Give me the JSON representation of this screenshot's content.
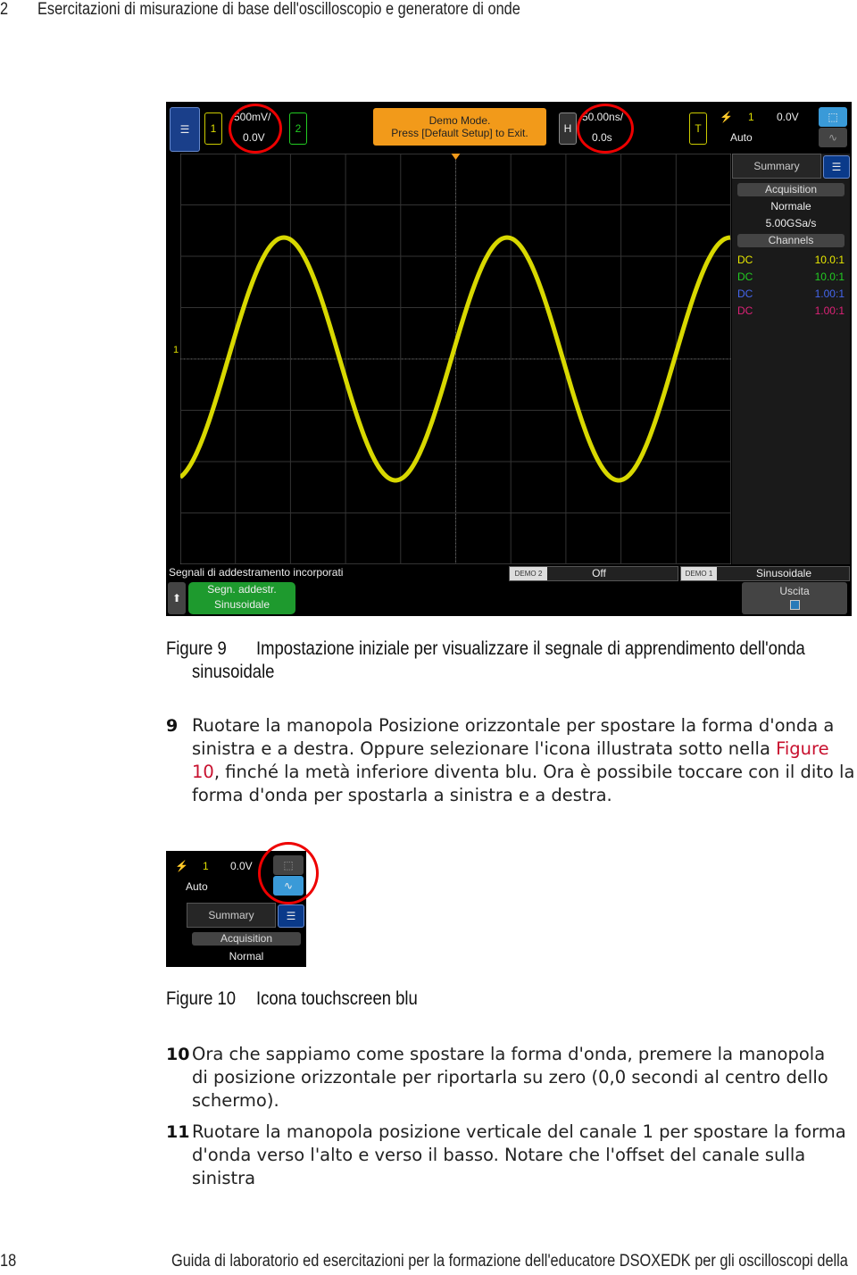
{
  "header": {
    "page_chapter": "2",
    "title": "Esercitazioni di misurazione di base dell'oscilloscopio e generatore di onde"
  },
  "scope": {
    "ch1": {
      "label": "1",
      "scale": "500mV/",
      "offset": "0.0V"
    },
    "ch2": {
      "label": "2"
    },
    "demo_banner": {
      "line1": "Demo Mode.",
      "line2": "Press [Default Setup] to Exit."
    },
    "horizontal": {
      "label": "H",
      "scale": "50.00ns/",
      "delay": "0.0s"
    },
    "trigger": {
      "label": "T",
      "source": "1",
      "level": "0.0V",
      "mode": "Auto"
    },
    "summary": {
      "tab": "Summary",
      "acq_header": "Acquisition",
      "acq_mode": "Normale",
      "sample_rate": "5.00GSa/s",
      "channels_header": "Channels",
      "channels": [
        {
          "coupling": "DC",
          "probe": "10.0:1",
          "color": "#e8e800"
        },
        {
          "coupling": "DC",
          "probe": "10.0:1",
          "color": "#22cc22"
        },
        {
          "coupling": "DC",
          "probe": "1.00:1",
          "color": "#4466ee"
        },
        {
          "coupling": "DC",
          "probe": "1.00:1",
          "color": "#dd2277"
        }
      ]
    },
    "ground_marker": "1",
    "trigger_marker": "T",
    "bottom": {
      "title": "Segnali di addestramento incorporati",
      "demo2_tag": "DEMO 2",
      "demo2_value": "Off",
      "demo1_tag": "DEMO 1",
      "demo1_value": "Sinusoidale",
      "signal_btn_line1": "Segn. addestr.",
      "signal_btn_line2": "Sinusoidale",
      "exit_label": "Uscita"
    },
    "trace_color": "#f0f000"
  },
  "figure9": {
    "label": "Figure 9",
    "caption_line1": "Impostazione iniziale per visualizzare il segnale di apprendimento dell'onda",
    "caption_line2": "sinusoidale"
  },
  "step9": {
    "num": "9",
    "text_a": "Ruotare la manopola Posizione orizzontale per spostare la forma d'onda a sinistra e a destra. Oppure selezionare l'icona illustrata sotto nella ",
    "link": "Figure 10",
    "text_b": ", finché la metà inferiore diventa blu. Ora è possibile toccare con il dito la forma d'onda per spostarla a sinistra e a destra."
  },
  "fig10_scope": {
    "trigger_source": "1",
    "trigger_level": "0.0V",
    "mode": "Auto",
    "tab": "Summary",
    "acq_header": "Acquisition",
    "acq_mode": "Normal"
  },
  "figure10": {
    "label": "Figure 10",
    "caption": "Icona touchscreen blu"
  },
  "step10": {
    "num": "10",
    "text": "Ora che sappiamo come spostare la forma d'onda, premere la manopola di posizione orizzontale per riportarla su zero (0,0 secondi al centro dello schermo)."
  },
  "step11": {
    "num": "11",
    "text": "Ruotare la manopola posizione verticale del canale 1 per spostare la forma d'onda verso l'alto e verso il basso. Notare che l'offset del canale sulla sinistra"
  },
  "footer": {
    "page_number": "18",
    "title": "Guida di laboratorio ed esercitazioni per la formazione dell'educatore DSOXEDK per gli oscilloscopi della"
  }
}
